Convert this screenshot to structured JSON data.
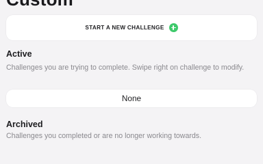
{
  "page": {
    "title": "Custom"
  },
  "start_card": {
    "label": "START A NEW CHALLENGE",
    "icon": "plus-circle-icon",
    "icon_color": "#3ec96b"
  },
  "active": {
    "heading": "Active",
    "description": "Challenges you are trying to complete. Swipe right on challenge to modify.",
    "empty_label": "None"
  },
  "archived": {
    "heading": "Archived",
    "description": "Challenges you completed or are no longer working towards."
  }
}
